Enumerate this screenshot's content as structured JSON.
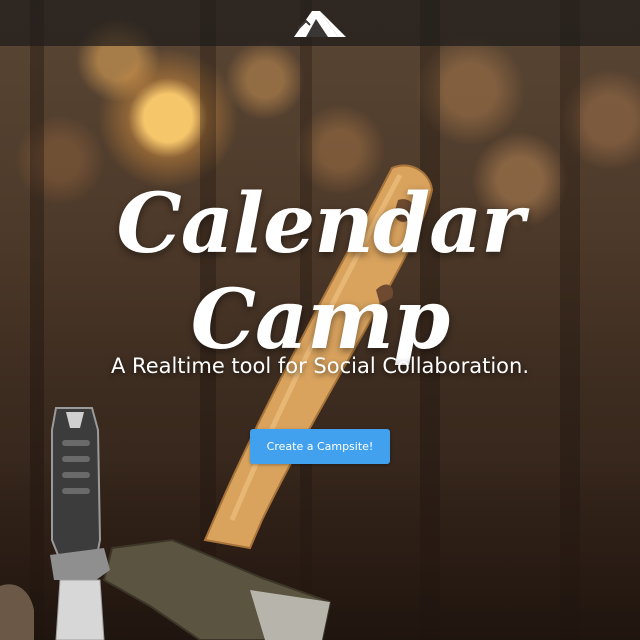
{
  "navbar": {
    "logo_icon": "tent-logo-icon"
  },
  "hero": {
    "title": "Calendar Camp",
    "subtitle": "A Realtime tool for Social Collaboration.",
    "cta_label": "Create a Campsite!"
  },
  "colors": {
    "cta_background": "#41a1ee",
    "title_text": "#ffffff",
    "navbar_background": "rgba(30,28,26,0.72)"
  }
}
